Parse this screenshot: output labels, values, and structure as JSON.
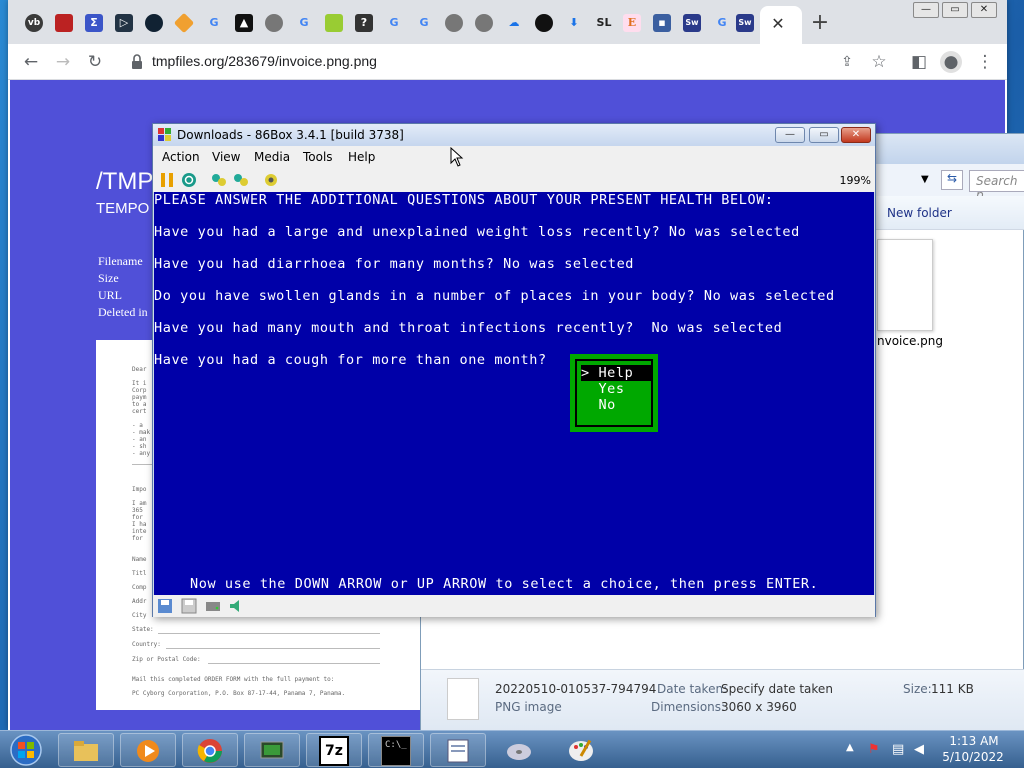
{
  "browser": {
    "url": "tmpfiles.org/283679/invoice.png.png",
    "tab_icons": [
      "vb",
      "G",
      "G",
      "G",
      "G",
      "G",
      "G",
      "SL",
      "E",
      "G",
      "Sw",
      "Sw"
    ],
    "new_tab": "+",
    "close_tab": "✕"
  },
  "page": {
    "title": "/TMP",
    "subtitle": "TEMPO",
    "meta_labels": [
      "Filename",
      "Size",
      "URL",
      "Deleted in"
    ],
    "doc_fragments": [
      "Dear",
      "It i",
      "Corp",
      "paym",
      "to a",
      "cert",
      "- a",
      "- mak",
      "- an",
      "- sh",
      "- any",
      "Impo",
      "I am",
      "365",
      "for",
      "I ha",
      "inte",
      "for",
      "Name",
      "Titl",
      "Comp",
      "Addr",
      "City",
      "State:",
      "Country:",
      "Zip or Postal Code:"
    ],
    "doc_footer_1": "Mail this completed ORDER FORM with the full payment to:",
    "doc_footer_2": "PC Cyborg Corporation, P.O. Box 87-17-44, Panama 7, Panama."
  },
  "explorer": {
    "search_placeholder": "Search p",
    "new_folder": "New folder",
    "thumb_label": "nvoice.png",
    "file_name": "20220510-010537-794794",
    "file_type": "PNG image",
    "date_taken_label": "Date taken:",
    "date_taken_value": "Specify date taken",
    "dimensions_label": "Dimensions:",
    "dimensions_value": "3060 x 3960",
    "size_label": "Size:",
    "size_value": "111 KB"
  },
  "box86": {
    "title": "Downloads - 86Box 3.4.1 [build 3738]",
    "menus": [
      "Action",
      "View",
      "Media",
      "Tools",
      "Help"
    ],
    "zoom": "199%",
    "lines": [
      "PLEASE ANSWER THE ADDITIONAL QUESTIONS ABOUT YOUR PRESENT HEALTH BELOW:",
      "Have you had a large and unexplained weight loss recently? No was selected",
      "Have you had diarrhoea for many months? No was selected",
      "Do you have swollen glands in a number of places in your body? No was selected",
      "Have you had many mouth and throat infections recently?  No was selected",
      "Have you had a cough for more than one month?"
    ],
    "options": [
      "> Help",
      "  Yes",
      "  No"
    ],
    "footer": "Now use the DOWN ARROW or UP ARROW to select a choice, then press ENTER."
  },
  "taskbar": {
    "time": "1:13 AM",
    "date": "5/10/2022",
    "apps": [
      "explorer",
      "media-player",
      "chrome",
      "86box",
      "7zip",
      "cmd",
      "notepad",
      "cd",
      "paint"
    ],
    "app_labels": {
      "7zip": "7z",
      "cmd": "C:\\_"
    }
  },
  "colors": {
    "dos_blue": "#0000a8",
    "dos_green": "#00a800",
    "page_bg": "#5050d8"
  }
}
